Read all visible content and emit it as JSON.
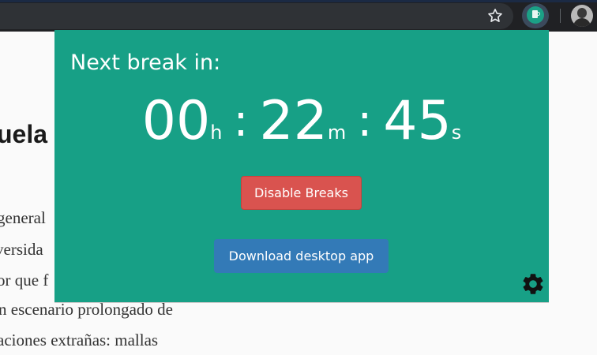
{
  "browser": {
    "icons": {
      "bookmark": "star-icon",
      "extension": "coffee-cup-icon",
      "profile": "avatar"
    }
  },
  "article": {
    "heading": "uela",
    "lines": [
      "general",
      "versida",
      "or que f",
      "n escenario prolongado de",
      "aciones extrañas: mallas"
    ]
  },
  "popup": {
    "title": "Next break in:",
    "timer": {
      "hours": "00",
      "hours_unit": "h",
      "minutes": "22",
      "minutes_unit": "m",
      "seconds": "45",
      "seconds_unit": "s",
      "separator": ":"
    },
    "disable_label": "Disable Breaks",
    "download_label": "Download desktop app",
    "settings_icon": "gear-icon"
  },
  "colors": {
    "popup_bg": "#17a086",
    "disable_button": "#d9534f",
    "download_button": "#337ab7",
    "toolbar": "#202124"
  }
}
